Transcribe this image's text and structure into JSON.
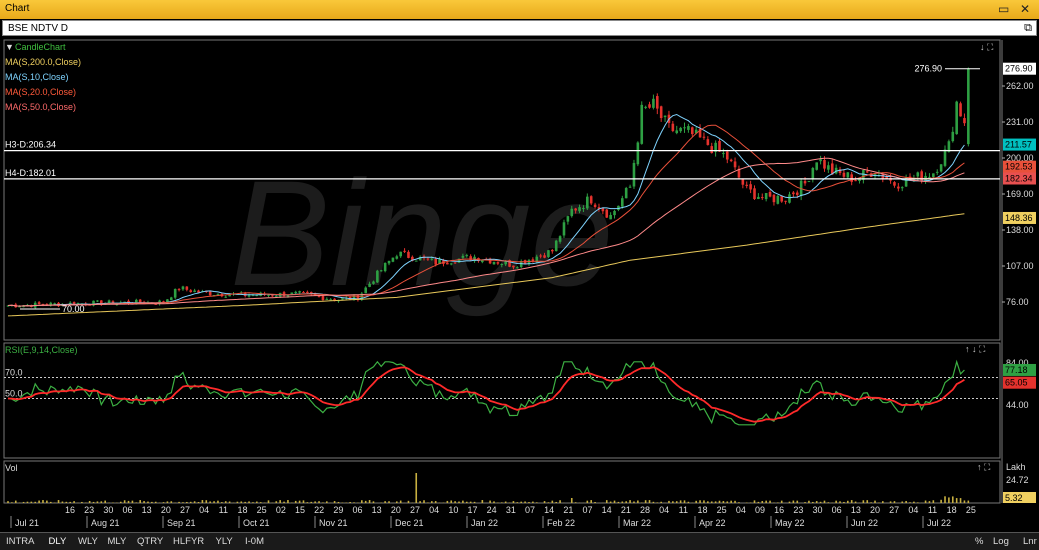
{
  "window": {
    "title": "Chart",
    "subtitle": "BSE NDTV D"
  },
  "legend": [
    {
      "label": "CandleChart",
      "color": "#3fbf3f"
    },
    {
      "label": "MA(S,200.0,Close)",
      "color": "#f0d060"
    },
    {
      "label": "MA(S,10,Close)",
      "color": "#7fd4ff"
    },
    {
      "label": "MA(S,20.0,Close)",
      "color": "#ff5a3a"
    },
    {
      "label": "MA(S,50.0,Close)",
      "color": "#ff6b6b"
    }
  ],
  "hlines": [
    {
      "label": "H3-D:206.34",
      "value": 206.34
    },
    {
      "label": "H4-D:182.01",
      "value": 182.01
    }
  ],
  "annotations": {
    "high": "276.90",
    "low": "70.00"
  },
  "rsi_panel": {
    "title": "RSI(E,9,14,Close)",
    "levels": [
      "70.0",
      "50.0"
    ],
    "ticks": [
      "84.00",
      "44.00"
    ],
    "badges": [
      "77.18",
      "65.05"
    ]
  },
  "vol_panel": {
    "title": "Vol",
    "unit": "Lakh",
    "ticks": [
      "24.72"
    ],
    "badge": "5.32"
  },
  "bottom": {
    "items": [
      "INTRA",
      "DLY",
      "WLY",
      "MLY",
      "QTRY",
      "HLFYR",
      "YLY",
      "I-0M"
    ],
    "selected": "DLY",
    "right": [
      "%",
      "Log",
      "Lnr"
    ]
  },
  "colors": {
    "up": "#2ea043",
    "down": "#e5322d",
    "ma200": "#e8c85a",
    "ma10": "#7fd4ff",
    "ma20": "#e8503a",
    "ma50": "#ff8a8a",
    "rsi": "#3cb043",
    "rsi_sig": "#ff2a2a"
  },
  "chart_data": {
    "type": "candlestick",
    "y_axis": {
      "ticks": [
        262,
        231,
        200,
        169,
        138,
        107,
        76
      ],
      "labels": [
        "262.00",
        "231.00",
        "200.00",
        "169.00",
        "138.00",
        "107.00",
        "76.00"
      ],
      "ylim": [
        55,
        290
      ],
      "badges": [
        {
          "value": 276.9,
          "label": "276.90"
        },
        {
          "value": 211.57,
          "label": "211.57"
        },
        {
          "value": 192.53,
          "label": "192.53"
        },
        {
          "value": 182.34,
          "label": "182.34"
        },
        {
          "value": 148.36,
          "label": "148.36"
        }
      ]
    },
    "x_ticks": [
      "16",
      "23",
      "30",
      "06",
      "13",
      "20",
      "27",
      "04",
      "11",
      "18",
      "25",
      "02",
      "15",
      "22",
      "29",
      "06",
      "13",
      "20",
      "27",
      "04",
      "10",
      "17",
      "24",
      "31",
      "07",
      "14",
      "21",
      "07",
      "14",
      "21",
      "28",
      "04",
      "11",
      "18",
      "25",
      "04",
      "09",
      "16",
      "23",
      "30",
      "06",
      "13",
      "20",
      "27",
      "04",
      "11",
      "18",
      "25"
    ],
    "x_months": [
      "Jul 21",
      "Aug 21",
      "Sep 21",
      "Oct 21",
      "Nov 21",
      "Dec 21",
      "Jan 22",
      "Feb 22",
      "Mar 22",
      "Apr 22",
      "May 22",
      "Jun 22",
      "Jul 22"
    ],
    "close_keypoints": [
      [
        0,
        73
      ],
      [
        20,
        75
      ],
      [
        40,
        76
      ],
      [
        44,
        88
      ],
      [
        50,
        84
      ],
      [
        60,
        82
      ],
      [
        75,
        83
      ],
      [
        85,
        78
      ],
      [
        90,
        80
      ],
      [
        95,
        100
      ],
      [
        100,
        118
      ],
      [
        110,
        110
      ],
      [
        120,
        115
      ],
      [
        130,
        108
      ],
      [
        140,
        120
      ],
      [
        145,
        155
      ],
      [
        150,
        165
      ],
      [
        155,
        150
      ],
      [
        160,
        175
      ],
      [
        163,
        240
      ],
      [
        166,
        245
      ],
      [
        170,
        225
      ],
      [
        175,
        222
      ],
      [
        180,
        212
      ],
      [
        185,
        200
      ],
      [
        190,
        172
      ],
      [
        195,
        165
      ],
      [
        200,
        166
      ],
      [
        205,
        178
      ],
      [
        208,
        200
      ],
      [
        212,
        188
      ],
      [
        218,
        182
      ],
      [
        223,
        190
      ],
      [
        228,
        178
      ],
      [
        233,
        182
      ],
      [
        238,
        188
      ],
      [
        242,
        210
      ],
      [
        244,
        248
      ],
      [
        246,
        230
      ]
    ],
    "ma200_keypoints": [
      [
        0,
        64
      ],
      [
        60,
        73
      ],
      [
        100,
        80
      ],
      [
        140,
        97
      ],
      [
        160,
        112
      ],
      [
        190,
        125
      ],
      [
        220,
        140
      ],
      [
        246,
        152
      ]
    ]
  }
}
